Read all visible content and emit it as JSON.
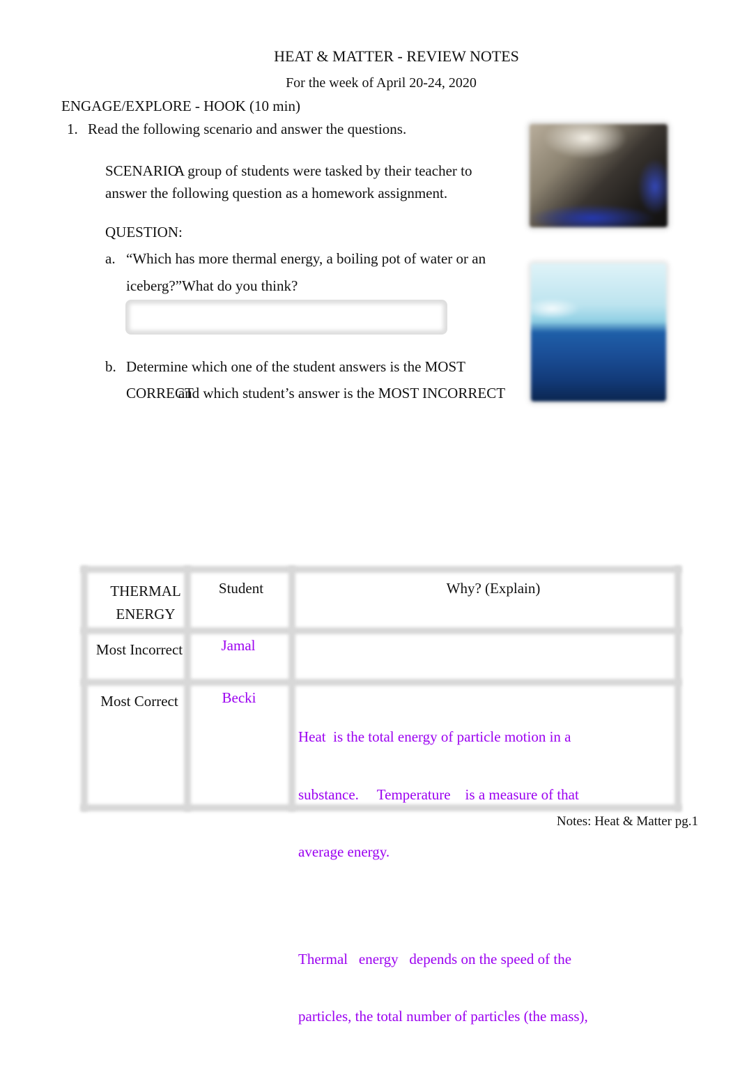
{
  "document": {
    "title": "HEAT & MATTER - REVIEW NOTES",
    "subtitle": "For the week of April 20-24, 2020",
    "section_heading": "ENGAGE/EXPLORE - HOOK (10 min)",
    "step": {
      "number": "1.",
      "text": "Read the following scenario and answer the questions."
    },
    "scenario": {
      "label": "SCENARIO",
      "line1": "A group of students were tasked by their teacher to",
      "line2": "answer the following question as a homework assignment."
    },
    "question_label": "QUESTION:",
    "questions": [
      {
        "marker": "a.",
        "line1": "“Which has more thermal energy, a boiling pot of water or an",
        "line2": "iceberg?”What do you think?",
        "answer_value": ""
      },
      {
        "marker": "b.",
        "line1": "Determine which one of the student answers is the MOST",
        "line2_a": "CORRECT",
        "line2_b": "and which student’s answer is the MOST INCORRECT"
      }
    ],
    "images": [
      {
        "icon": "boiling-pot-photo"
      },
      {
        "icon": "iceberg-photo"
      }
    ],
    "table": {
      "headers": [
        "THERMAL ENERGY",
        "Student",
        "Why? (Explain)"
      ],
      "header_col1_lines": [
        "THERMAL",
        "ENERGY"
      ],
      "rows": [
        {
          "label": "Most Incorrect",
          "student": "Jamal",
          "why": []
        },
        {
          "label": "Most Correct",
          "student": "Becki",
          "why": [
            "Heat  is the total energy of particle motion in a",
            "substance.     Temperature    is a measure of that",
            "average energy.",
            "",
            "Thermal   energy   depends on the speed of the",
            "particles, the total number of particles (the mass),"
          ]
        }
      ]
    },
    "footer": "Notes: Heat & Matter pg.1",
    "colors": {
      "answer_text": "#9b00f0",
      "body_text": "#111111"
    }
  }
}
